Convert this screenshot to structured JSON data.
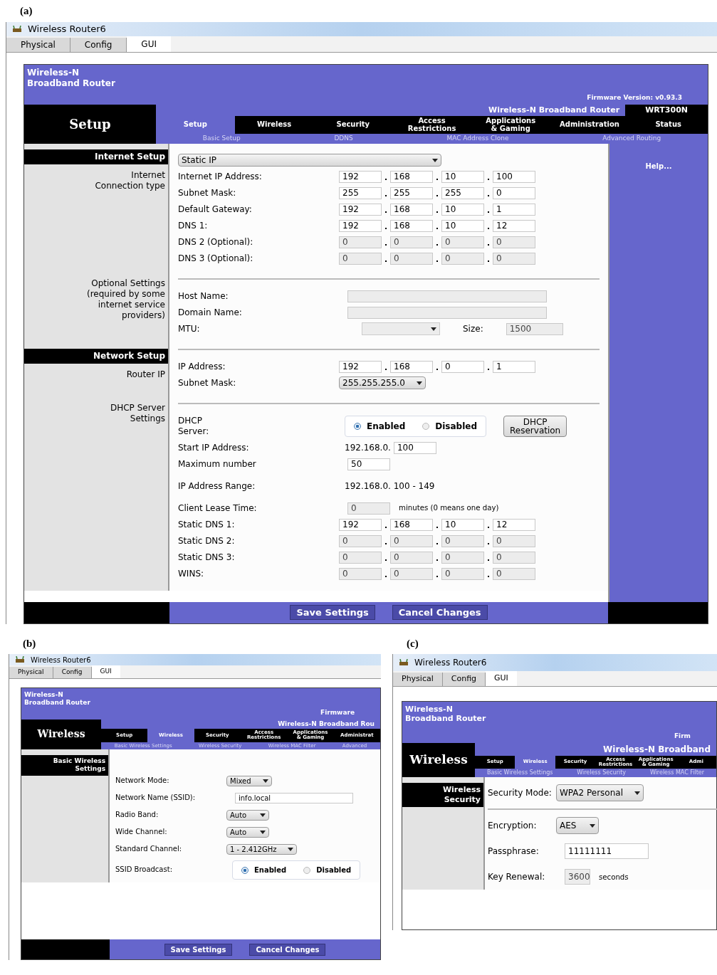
{
  "panels": [
    {
      "label": "(a)",
      "window_title": "Wireless Router6",
      "tabs": [
        {
          "label": "Physical",
          "selected": false
        },
        {
          "label": "Config",
          "selected": false
        },
        {
          "label": "GUI",
          "selected": true
        }
      ],
      "brand": "Wireless-N\nBroadband Router",
      "firmware": "Firmware Version: v0.93.3",
      "section_title": "Setup",
      "banner": "Wireless-N Broadband Router",
      "model": "WRT300N",
      "menu": [
        {
          "label": "Setup",
          "selected": true
        },
        {
          "label": "Wireless",
          "selected": false
        },
        {
          "label": "Security",
          "selected": false
        },
        {
          "label": "Access\nRestrictions",
          "selected": false
        },
        {
          "label": "Applications\n& Gaming",
          "selected": false
        },
        {
          "label": "Administration",
          "selected": false
        },
        {
          "label": "Status",
          "selected": false
        }
      ],
      "submenu": [
        "Basic Setup",
        "DDNS",
        "MAC Address Clone",
        "Advanced Routing"
      ],
      "sections": [
        {
          "header": "Internet Setup",
          "label": "Internet\nConnection type",
          "rows": [
            {
              "kind": "select",
              "value": "Static IP"
            },
            {
              "kind": "ip",
              "label": "Internet IP Address:",
              "octets": [
                "192",
                "168",
                "10",
                "100"
              ],
              "disabled": false
            },
            {
              "kind": "ip",
              "label": "Subnet Mask:",
              "octets": [
                "255",
                "255",
                "255",
                "0"
              ],
              "disabled": false
            },
            {
              "kind": "ip",
              "label": "Default Gateway:",
              "octets": [
                "192",
                "168",
                "10",
                "1"
              ],
              "disabled": false
            },
            {
              "kind": "ip",
              "label": "DNS 1:",
              "octets": [
                "192",
                "168",
                "10",
                "12"
              ],
              "disabled": false
            },
            {
              "kind": "ip",
              "label": "DNS 2 (Optional):",
              "octets": [
                "0",
                "0",
                "0",
                "0"
              ],
              "disabled": true
            },
            {
              "kind": "ip",
              "label": "DNS 3 (Optional):",
              "octets": [
                "0",
                "0",
                "0",
                "0"
              ],
              "disabled": true
            }
          ]
        },
        {
          "label": "Optional Settings\n(required by some\ninternet service\nproviders)",
          "rows": [
            {
              "kind": "text_field",
              "label": "Host Name:",
              "disabled": true
            },
            {
              "kind": "text_field",
              "label": "Domain Name:",
              "disabled": true
            },
            {
              "kind": "mtu",
              "label": "MTU:",
              "size_label": "Size:",
              "size": "1500",
              "disabled": true
            }
          ]
        },
        {
          "header": "Network Setup",
          "label": "Router IP",
          "rows": [
            {
              "kind": "ip",
              "label": "IP Address:",
              "octets": [
                "192",
                "168",
                "0",
                "1"
              ],
              "disabled": false
            },
            {
              "kind": "select",
              "label": "Subnet Mask:",
              "value": "255.255.255.0"
            }
          ]
        },
        {
          "label": "DHCP Server\nSettings",
          "rows": [
            {
              "kind": "radio",
              "label": "DHCP\nServer:",
              "options": [
                {
                  "label": "Enabled",
                  "selected": true
                },
                {
                  "label": "Disabled",
                  "selected": false
                }
              ],
              "button": "DHCP\nReservation"
            },
            {
              "kind": "prefixed",
              "label": "Start IP Address:",
              "prefix": "192.168.0.",
              "value": "100"
            },
            {
              "kind": "number_field",
              "label": "Maximum number",
              "value": "50",
              "disabled": false
            },
            {
              "kind": "text",
              "label": "IP Address Range:",
              "value": "192.168.0. 100 - 149"
            },
            {
              "kind": "number_field",
              "label": "Client Lease Time:",
              "value": "0",
              "disabled": true,
              "suffix": "minutes (0 means one day)"
            },
            {
              "kind": "ip",
              "label": "Static DNS 1:",
              "octets": [
                "192",
                "168",
                "10",
                "12"
              ],
              "disabled": false
            },
            {
              "kind": "ip",
              "label": "Static DNS 2:",
              "octets": [
                "0",
                "0",
                "0",
                "0"
              ],
              "disabled": true
            },
            {
              "kind": "ip",
              "label": "Static DNS 3:",
              "octets": [
                "0",
                "0",
                "0",
                "0"
              ],
              "disabled": true
            },
            {
              "kind": "ip",
              "label": "WINS:",
              "octets": [
                "0",
                "0",
                "0",
                "0"
              ],
              "disabled": true
            }
          ]
        }
      ],
      "help": "Help...",
      "buttons": [
        "Save Settings",
        "Cancel Changes"
      ]
    },
    {
      "label": "(b)",
      "window_title": "Wireless Router6",
      "tabs": [
        {
          "label": "Physical",
          "selected": false
        },
        {
          "label": "Config",
          "selected": false
        },
        {
          "label": "GUI",
          "selected": true
        }
      ],
      "brand": "Wireless-N\nBroadband Router",
      "firmware": "Firmware",
      "section_title": "Wireless",
      "banner": "Wireless-N Broadband Rou",
      "menu": [
        {
          "label": "Setup",
          "selected": false
        },
        {
          "label": "Wireless",
          "selected": true
        },
        {
          "label": "Security",
          "selected": false
        },
        {
          "label": "Access\nRestrictions",
          "selected": false
        },
        {
          "label": "Applications\n& Gaming",
          "selected": false
        },
        {
          "label": "Administrat",
          "selected": false
        }
      ],
      "submenu": [
        "Basic Wireless Settings",
        "Wireless Security",
        "Wireless MAC Filter",
        "Advanced"
      ],
      "sections": [
        {
          "header": "Basic Wireless\nSettings",
          "rows": [
            {
              "kind": "select",
              "label": "Network Mode:",
              "value": "Mixed"
            },
            {
              "kind": "text_field",
              "label": "Network Name (SSID):",
              "value": "info.local",
              "disabled": false
            },
            {
              "kind": "select",
              "label": "Radio Band:",
              "value": "Auto"
            },
            {
              "kind": "select",
              "label": "Wide Channel:",
              "value": "Auto"
            },
            {
              "kind": "select",
              "label": "Standard Channel:",
              "value": "1 - 2.412GHz"
            },
            {
              "kind": "radio",
              "label": "SSID Broadcast:",
              "options": [
                {
                  "label": "Enabled",
                  "selected": true
                },
                {
                  "label": "Disabled",
                  "selected": false
                }
              ]
            }
          ]
        }
      ],
      "buttons": [
        "Save Settings",
        "Cancel Changes"
      ]
    },
    {
      "label": "(c)",
      "window_title": "Wireless Router6",
      "tabs": [
        {
          "label": "Physical",
          "selected": false
        },
        {
          "label": "Config",
          "selected": false
        },
        {
          "label": "GUI",
          "selected": true
        }
      ],
      "brand": "Wireless-N\nBroadband Router",
      "firmware": "Firm",
      "section_title": "Wireless",
      "banner": "Wireless-N Broadband",
      "menu": [
        {
          "label": "Setup",
          "selected": false
        },
        {
          "label": "Wireless",
          "selected": true
        },
        {
          "label": "Security",
          "selected": false
        },
        {
          "label": "Access\nRestrictions",
          "selected": false
        },
        {
          "label": "Applications\n& Gaming",
          "selected": false
        },
        {
          "label": "Admi",
          "selected": false
        }
      ],
      "submenu": [
        "Basic Wireless Settings",
        "Wireless Security",
        "Wireless MAC Filter"
      ],
      "sections": [
        {
          "header": "Wireless\nSecurity",
          "rows": [
            {
              "kind": "select",
              "label": "Security Mode:",
              "value": "WPA2 Personal"
            },
            {
              "kind": "divider"
            },
            {
              "kind": "select",
              "label": "Encryption:",
              "value": "AES"
            },
            {
              "kind": "text_field",
              "label": "Passphrase:",
              "value": "11111111",
              "disabled": false
            },
            {
              "kind": "number_field",
              "label": "Key Renewal:",
              "value": "3600",
              "disabled": true,
              "suffix": "seconds"
            }
          ]
        }
      ]
    }
  ]
}
